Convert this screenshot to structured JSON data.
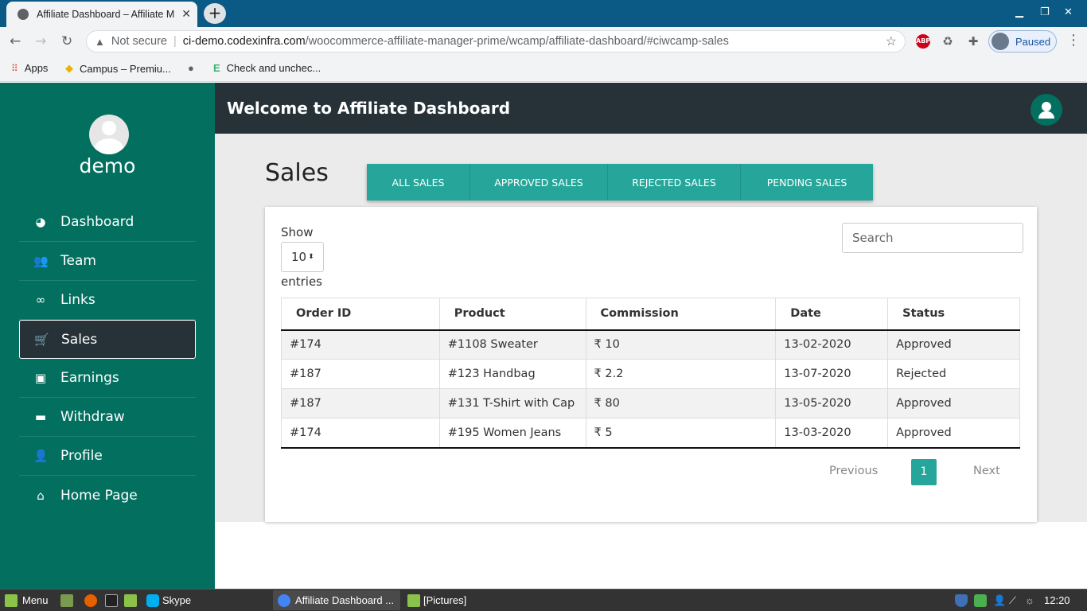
{
  "browser": {
    "tab_title": "Affiliate Dashboard – Affiliate M",
    "tab_close": "✕",
    "new_tab": "+",
    "security_label": "Not secure",
    "url_host": "ci-demo.codexinfra.com",
    "url_path": "/woocommerce-affiliate-manager-prime/wcamp/affiliate-dashboard/#ciwcamp-sales",
    "profile_status": "Paused",
    "abp_label": "ABP"
  },
  "bookmarks": [
    {
      "label": "Apps",
      "icon": "apps-grid-icon"
    },
    {
      "label": "Campus – Premiu...",
      "icon": "campus-icon"
    },
    {
      "label": "",
      "icon": "globe-icon"
    },
    {
      "label": "Check and unchec...",
      "icon": "e-icon"
    }
  ],
  "sidebar": {
    "username": "demo",
    "items": [
      {
        "label": "Dashboard",
        "icon": "pie-chart-icon"
      },
      {
        "label": "Team",
        "icon": "users-icon"
      },
      {
        "label": "Links",
        "icon": "link-icon"
      },
      {
        "label": "Sales",
        "icon": "cart-icon",
        "active": true
      },
      {
        "label": "Earnings",
        "icon": "money-icon"
      },
      {
        "label": "Withdraw",
        "icon": "credit-card-icon"
      },
      {
        "label": "Profile",
        "icon": "user-icon"
      },
      {
        "label": "Home Page",
        "icon": "home-icon"
      }
    ]
  },
  "header": {
    "title": "Welcome to Affiliate Dashboard"
  },
  "page": {
    "title": "Sales",
    "tabs": [
      "ALL SALES",
      "APPROVED SALES",
      "REJECTED SALES",
      "PENDING SALES"
    ]
  },
  "table_controls": {
    "show_label": "Show",
    "entries_value": "10",
    "entries_label": "entries",
    "search_placeholder": "Search"
  },
  "table": {
    "columns": [
      "Order ID",
      "Product",
      "Commission",
      "Date",
      "Status"
    ],
    "rows": [
      [
        "#174",
        "#1108 Sweater",
        "₹ 10",
        "13-02-2020",
        "Approved"
      ],
      [
        "#187",
        "#123 Handbag",
        "₹ 2.2",
        "13-07-2020",
        "Rejected"
      ],
      [
        "#187",
        "#131 T-Shirt with Cap",
        "₹ 80",
        "13-05-2020",
        "Approved"
      ],
      [
        "#174",
        "#195 Women Jeans",
        "₹ 5",
        "13-03-2020",
        "Approved"
      ]
    ]
  },
  "pagination": {
    "previous": "Previous",
    "current": "1",
    "next": "Next"
  },
  "taskbar": {
    "menu": "Menu",
    "skype": "Skype",
    "window1": "Affiliate Dashboard ...",
    "window2": "[Pictures]",
    "clock": "12:20"
  },
  "colors": {
    "sidebar": "#036f5f",
    "header": "#263238",
    "accent": "#26a69a"
  }
}
